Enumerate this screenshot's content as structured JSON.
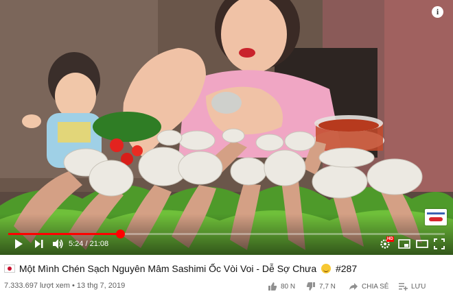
{
  "video": {
    "title_text": "Một Mình Chén Sạch Nguyên Mâm Sashimi Ốc Vòi Voi - Dễ Sợ Chưa",
    "title_tag": "#287",
    "time_display": "5:24 / 21:08",
    "progress_fraction": 0.256,
    "hd_badge": "HD",
    "flag_icon": "vietnam-japan-flag-icon",
    "emoji_icon": "grinning-sweat-emoji-icon"
  },
  "stats": {
    "views_and_date": "7.333.697 lượt xem • 13 thg 7, 2019"
  },
  "actions": {
    "like_count": "80 N",
    "dislike_count": "7,7 N",
    "share_label": "CHIA SẺ",
    "save_label": "LƯU"
  },
  "colors": {
    "progress": "#ff0000",
    "text_primary": "#111111",
    "text_secondary": "#606060"
  }
}
